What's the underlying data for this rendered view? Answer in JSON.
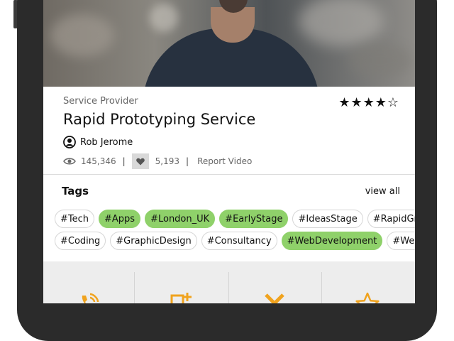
{
  "colors": {
    "accent_green": "#8fd16a",
    "action_orange": "#f0a31e"
  },
  "listing": {
    "category": "Service Provider",
    "title": "Rapid Prototyping Service",
    "rating": "★★★★☆",
    "author": "Rob Jerome",
    "views": "145,346",
    "likes": "5,193",
    "separator": "|",
    "report_label": "Report Video"
  },
  "tags": {
    "heading": "Tags",
    "view_all": "view all",
    "row1": [
      {
        "label": "#Tech",
        "active": false
      },
      {
        "label": "#Apps",
        "active": true
      },
      {
        "label": "#London_UK",
        "active": true
      },
      {
        "label": "#EarlyStage",
        "active": true
      },
      {
        "label": "#IdeasStage",
        "active": false
      },
      {
        "label": "#RapidGrowth",
        "active": false
      }
    ],
    "row2": [
      {
        "label": "#Coding",
        "active": false
      },
      {
        "label": "#GraphicDesign",
        "active": false
      },
      {
        "label": "#Consultancy",
        "active": false
      },
      {
        "label": "#WebDevelopment",
        "active": true
      },
      {
        "label": "#Websites",
        "active": false
      }
    ]
  },
  "action_bar": {
    "icons": [
      "phone-call-icon",
      "add-document-icon",
      "close-icon",
      "star-icon"
    ]
  }
}
